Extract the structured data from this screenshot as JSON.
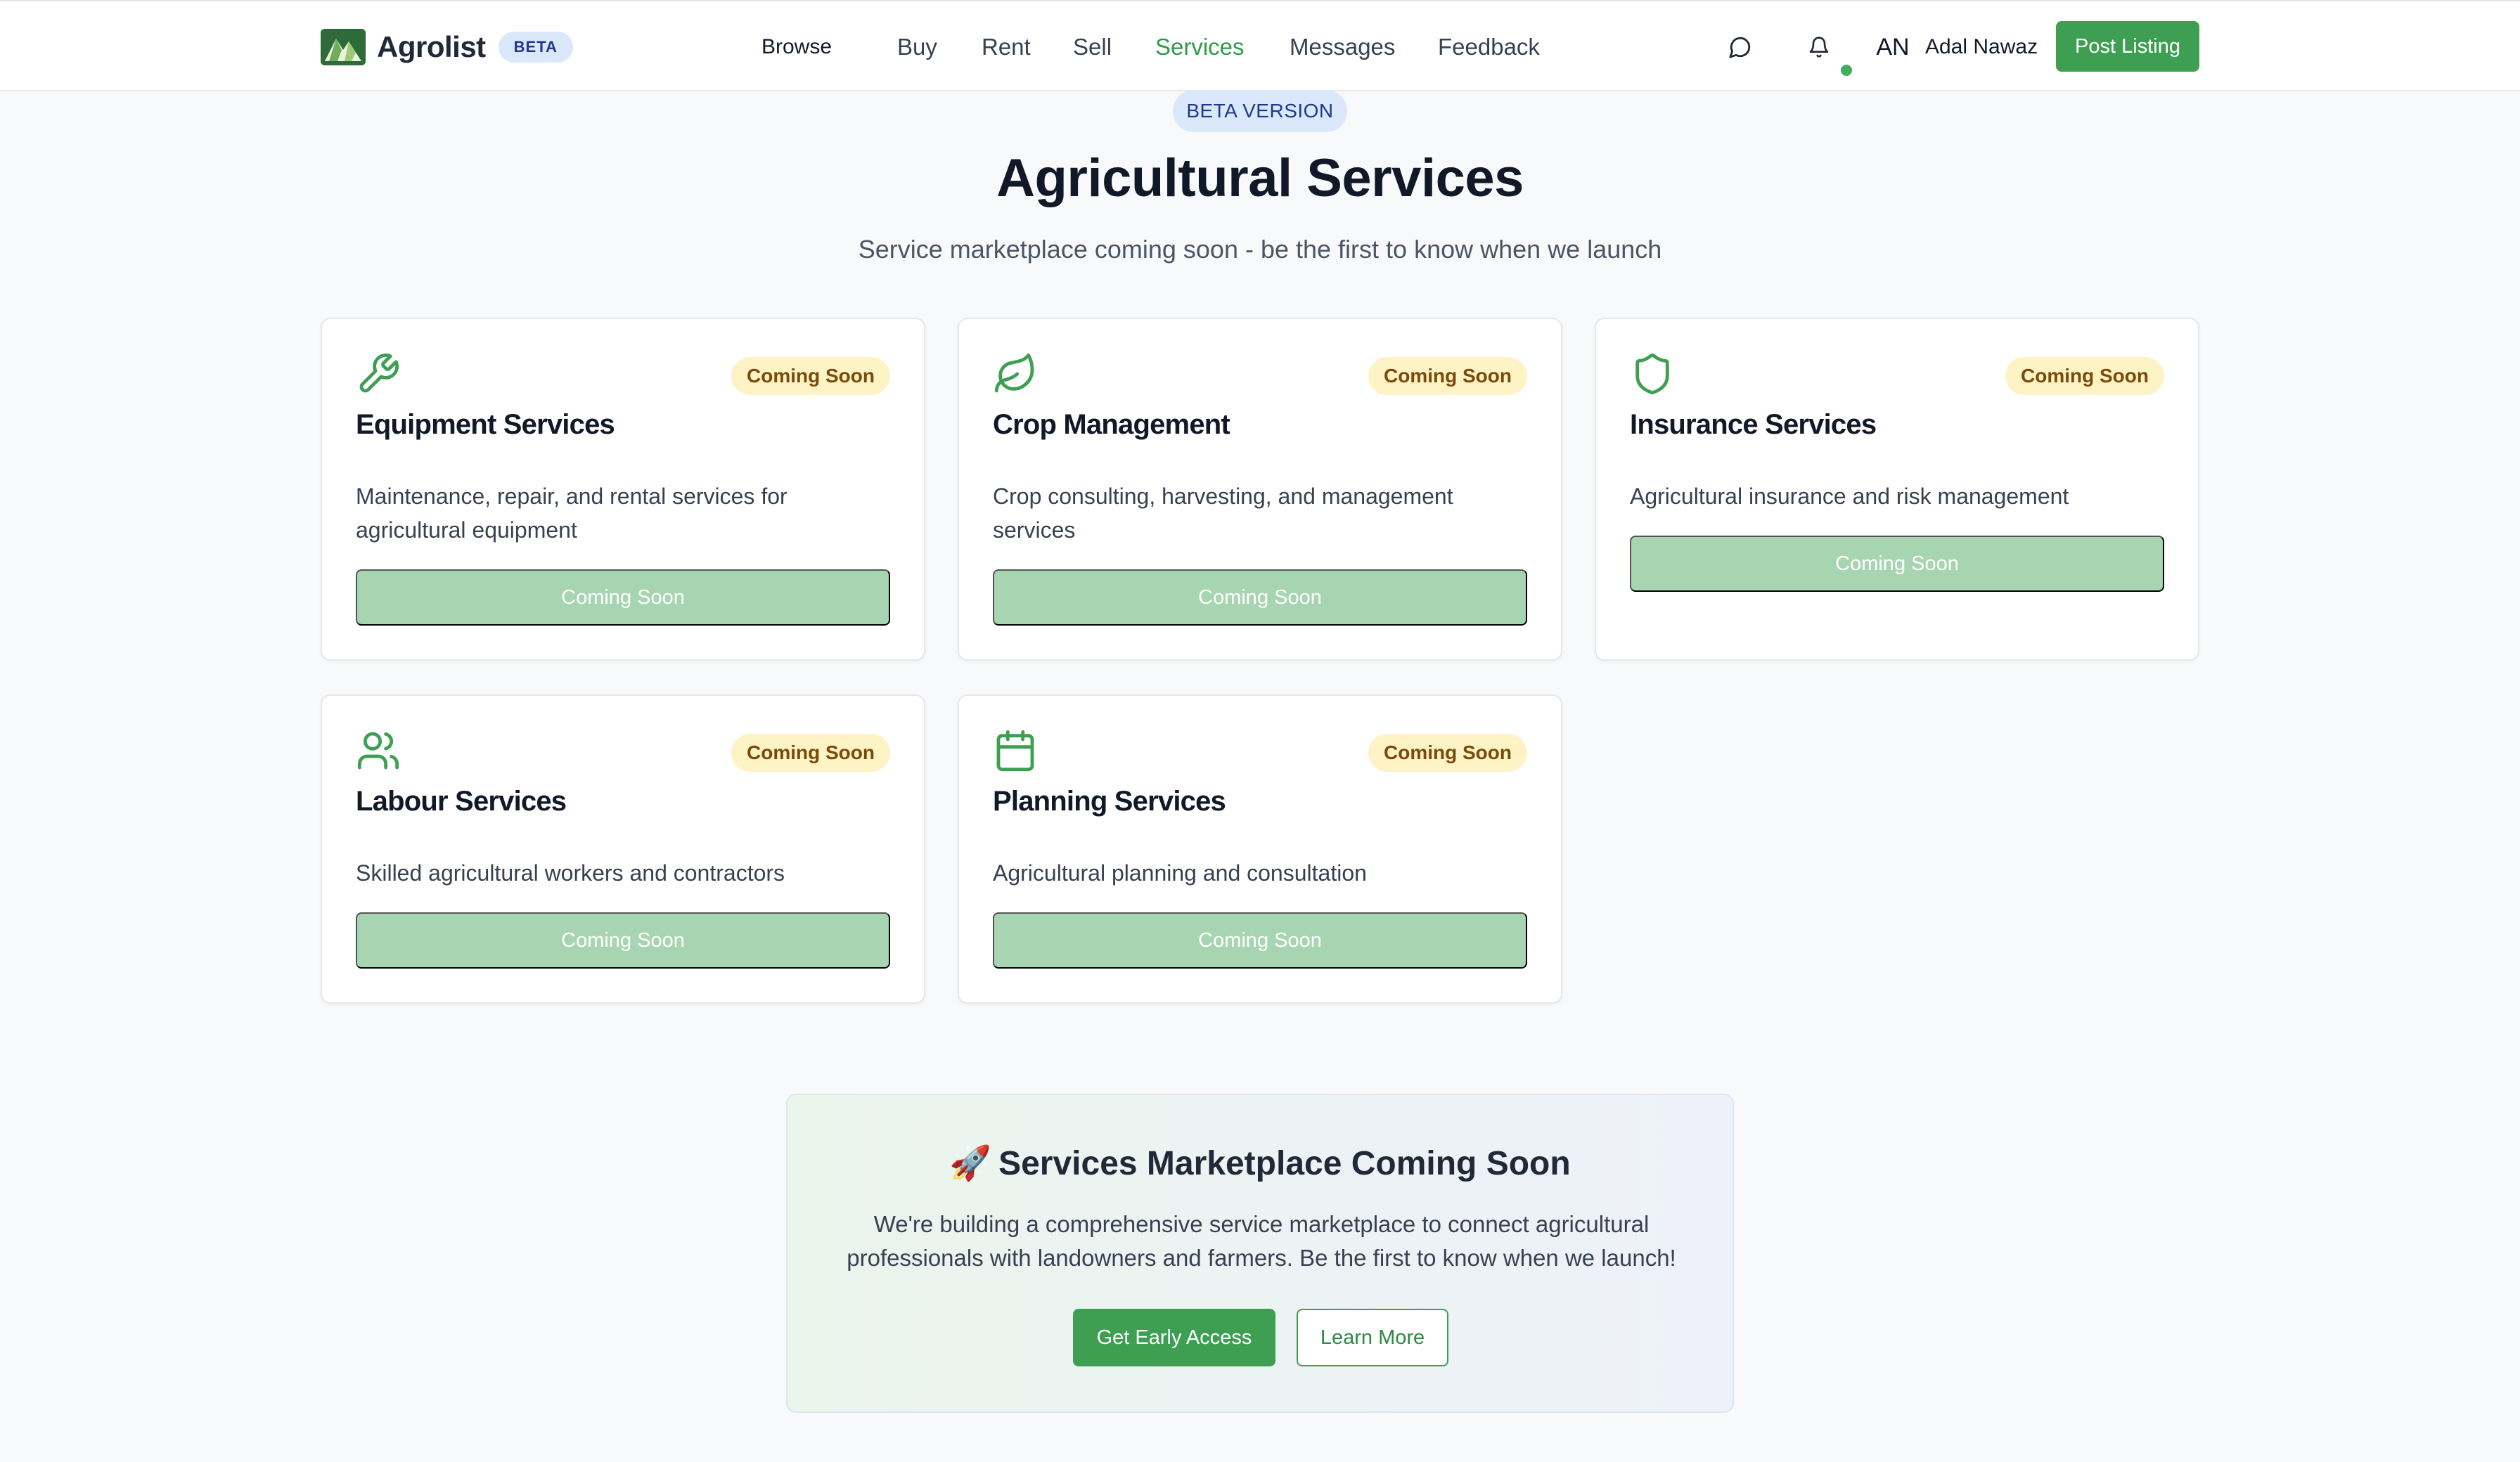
{
  "nav": {
    "brand": "Agrolist",
    "beta_badge": "BETA",
    "links": [
      "Browse",
      "Buy",
      "Rent",
      "Sell",
      "Services",
      "Messages",
      "Feedback"
    ],
    "active": "Services",
    "icons": [
      "message-icon",
      "bell-icon"
    ],
    "user": {
      "initials": "AN",
      "name": "Adal Nawaz"
    },
    "post_listing": "Post Listing"
  },
  "hero": {
    "badge": "BETA VERSION",
    "title": "Agricultural Services",
    "subtitle": "Service marketplace coming soon - be the first to know when we launch"
  },
  "cards": [
    {
      "icon": "wrench-icon",
      "badge": "Coming Soon",
      "title": "Equipment Services",
      "description": "Maintenance, repair, and rental services for agricultural equipment",
      "button": "Coming Soon"
    },
    {
      "icon": "leaf-icon",
      "badge": "Coming Soon",
      "title": "Crop Management",
      "description": "Crop consulting, harvesting, and management services",
      "button": "Coming Soon"
    },
    {
      "icon": "shield-icon",
      "badge": "Coming Soon",
      "title": "Insurance Services",
      "description": "Agricultural insurance and risk management",
      "button": "Coming Soon"
    },
    {
      "icon": "users-icon",
      "badge": "Coming Soon",
      "title": "Labour Services",
      "description": "Skilled agricultural workers and contractors",
      "button": "Coming Soon"
    },
    {
      "icon": "calendar-icon",
      "badge": "Coming Soon",
      "title": "Planning Services",
      "description": "Agricultural planning and consultation",
      "button": "Coming Soon"
    }
  ],
  "cta": {
    "emoji": "🚀",
    "title": "Services Marketplace Coming Soon",
    "text": "We're building a comprehensive service marketplace to connect agricultural professionals with landowners and farmers. Be the first to know when we launch!",
    "primary": "Get Early Access",
    "secondary": "Learn More"
  },
  "colors": {
    "accent": "#3e9f53",
    "accent_text": "#2e9a4a",
    "disabled_button": "#a8d5b1",
    "badge_yellow": "#fdf3c4",
    "badge_blue": "#dbe8fb"
  }
}
